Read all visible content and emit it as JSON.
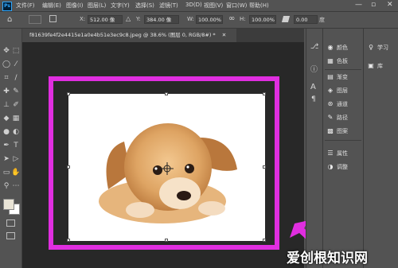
{
  "menubar": {
    "logo": "Ps",
    "items": [
      "文件(F)",
      "编辑(E)",
      "图像(I)",
      "图层(L)",
      "文字(Y)",
      "选择(S)",
      "滤镜(T)",
      "3D(D)",
      "视图(V)",
      "窗口(W)",
      "帮助(H)"
    ],
    "minimize": "—",
    "maximize": "▫",
    "close": "✕"
  },
  "options": {
    "x_label": "X:",
    "x_value": "512.00 像",
    "y_label": "Y:",
    "y_value": "384.00 像",
    "w_label": "W:",
    "w_value": "100.00%",
    "link_glyph": "∞",
    "h_label": "H:",
    "h_value": "100.00%",
    "angle_value": "0.00",
    "angle_unit": "度"
  },
  "document": {
    "tab_title": "f81639fe4f2e4415e1a0e4b51e3ec9c8.jpeg @ 38.6% (图层 0, RGB/8#) *",
    "tab_close": "✕"
  },
  "panels": {
    "col2": [
      "颜色",
      "色板",
      "渐变",
      "图层",
      "通道",
      "路径",
      "图案",
      "属性",
      "调整"
    ],
    "col3": [
      "学习",
      "库"
    ]
  },
  "watermark": "爱创根知识网",
  "colors": {
    "accent_frame": "#e02ee0",
    "arrow": "#e02ee0",
    "bg": "#535353",
    "canvas": "#282828"
  }
}
